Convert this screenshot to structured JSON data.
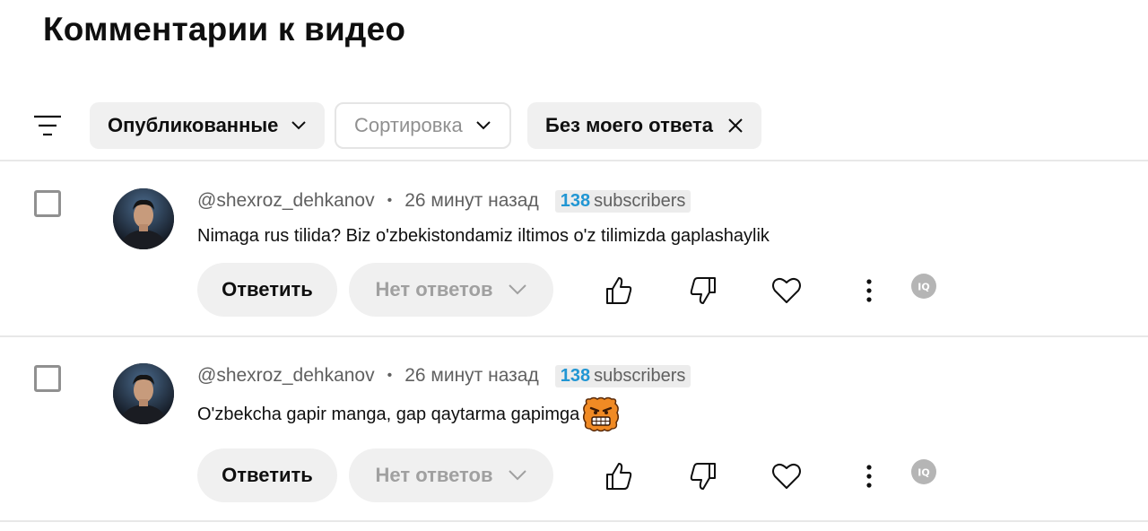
{
  "page": {
    "title": "Комментарии к видео"
  },
  "filters": {
    "published_label": "Опубликованные",
    "sort_label": "Сортировка",
    "no_reply_label": "Без моего ответа"
  },
  "comments": [
    {
      "author": "@shexroz_dehkanov",
      "dot": "•",
      "time": "26 минут назад",
      "subscribers_count": "138",
      "subscribers_label": "subscribers",
      "text": "Nimaga rus tilida? Biz o'zbekistondamiz iltimos o'z tilimizda gaplashaylik",
      "reply_label": "Ответить",
      "replies_label": "Нет ответов"
    },
    {
      "author": "@shexroz_dehkanov",
      "dot": "•",
      "time": "26 минут назад",
      "subscribers_count": "138",
      "subscribers_label": "subscribers",
      "text": "O'zbekcha gapir manga, gap qaytarma gapimga",
      "reply_label": "Ответить",
      "replies_label": "Нет ответов"
    }
  ],
  "colors": {
    "accent_blue": "#2196d3",
    "chip_bg": "#f0f0f0",
    "meta_gray": "#606060"
  },
  "icons": [
    "filter-icon",
    "chevron-down-icon",
    "close-icon",
    "like-icon",
    "dislike-icon",
    "heart-icon",
    "more-vert-icon",
    "iq-icon",
    "angry-emoji-icon"
  ]
}
